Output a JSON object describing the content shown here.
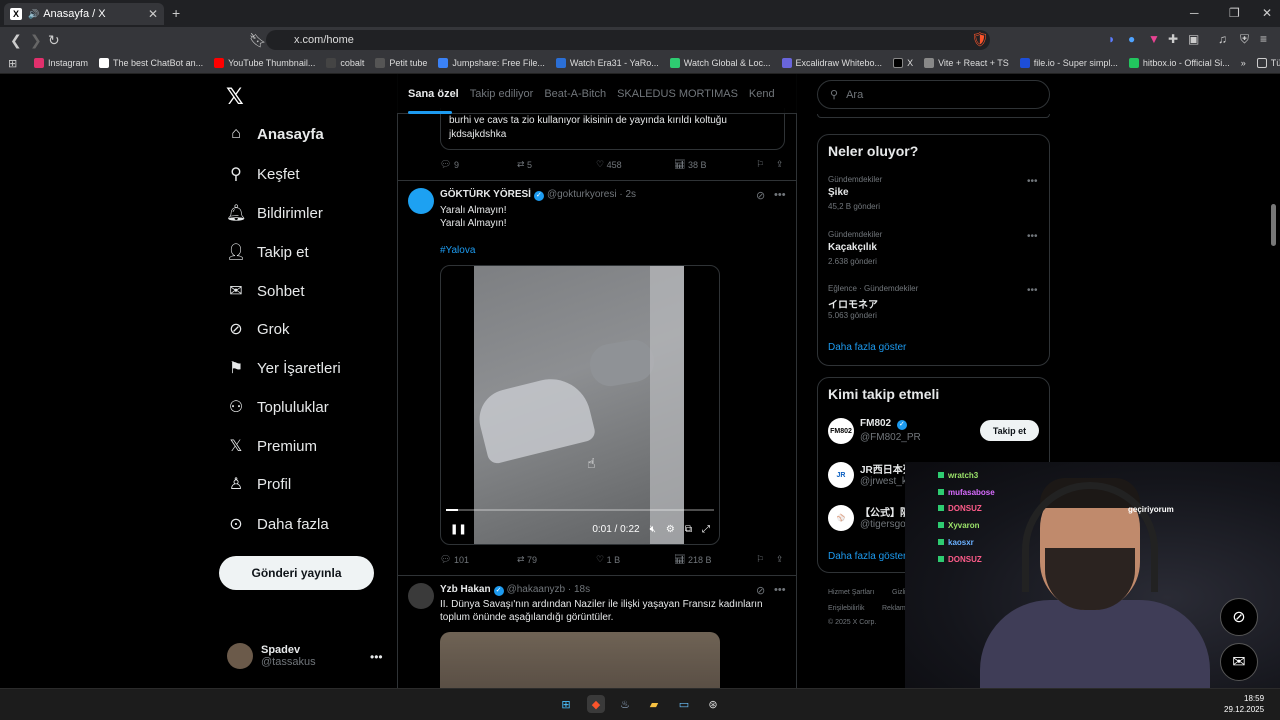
{
  "browser": {
    "tab_title": "Anasayfa / X",
    "url": "x.com/home",
    "bookmarks": [
      "Instagram",
      "The best ChatBot an...",
      "YouTube Thumbnail...",
      "cobalt",
      "Petit tube",
      "Jumpshare: Free File...",
      "Watch Era31 - YaRo...",
      "Watch Global & Loc...",
      "Excalidraw Whitebo...",
      "X",
      "Vite + React + TS",
      "file.io - Super simpl...",
      "hitbox.io - Official Si..."
    ],
    "all_bookmarks": "Tüm Yer İşaretleri"
  },
  "sidebar": {
    "items": [
      {
        "label": "Anasayfa",
        "icon": "home-icon"
      },
      {
        "label": "Keşfet",
        "icon": "search-icon"
      },
      {
        "label": "Bildirimler",
        "icon": "bell-icon"
      },
      {
        "label": "Takip et",
        "icon": "add-person-icon"
      },
      {
        "label": "Sohbet",
        "icon": "mail-icon"
      },
      {
        "label": "Grok",
        "icon": "grok-icon"
      },
      {
        "label": "Yer İşaretleri",
        "icon": "bookmark-icon"
      },
      {
        "label": "Topluluklar",
        "icon": "communities-icon"
      },
      {
        "label": "Premium",
        "icon": "x-logo-icon"
      },
      {
        "label": "Profil",
        "icon": "person-icon"
      },
      {
        "label": "Daha fazla",
        "icon": "more-icon"
      }
    ],
    "post_button": "Gönderi yayınla",
    "user_name": "Spadev",
    "user_handle": "@tassakus"
  },
  "timeline": {
    "tabs": [
      "Sana özel",
      "Takip ediliyor",
      "Beat-A-Bitch",
      "SKALEDUS MORTIMAS",
      "Kend"
    ],
    "quote_text_1": "burhi ve cavs ta zio kullanıyor ikisinin de yayında kırıldı koltuğu",
    "quote_text_2": "jkdsajkdshka",
    "quote_actions": {
      "replies": "9",
      "reposts": "5",
      "likes": "458",
      "views": "38 B"
    },
    "tweet1": {
      "name": "GÖKTÜRK YÖRESİ",
      "handle": "@gokturkyoresi",
      "time": "· 2s",
      "line1": "Yaralı Almayın!",
      "line2": "Yaralı Almayın!",
      "hashtag": "#Yalova",
      "video_time": "0:01 / 0:22",
      "video_progress": 0.045,
      "replies": "101",
      "reposts": "79",
      "likes": "1 B",
      "views": "218 B"
    },
    "tweet2": {
      "name": "Yzb Hakan",
      "handle": "@hakaanyzb",
      "time": "· 18s",
      "line1": "II. Dünya Savaşı'nın ardından Naziler ile ilişki yaşayan Fransız kadınların",
      "line2": "toplum önünde aşağılandığı görüntüler."
    }
  },
  "right": {
    "search_placeholder": "Ara",
    "trends_title": "Neler oluyor?",
    "trends": [
      {
        "meta": "Gündemdekiler",
        "name": "Şike",
        "count": "45,2 B gönderi"
      },
      {
        "meta": "Gündemdekiler",
        "name": "Kaçakçılık",
        "count": "2.638 gönderi"
      },
      {
        "meta": "Eğlence · Gündemdekiler",
        "name": "イロモネア",
        "count": "5.063 gönderi"
      }
    ],
    "show_more": "Daha fazla göster",
    "who_title": "Kimi takip etmeli",
    "who": [
      {
        "name": "FM802",
        "handle": "@FM802_PR",
        "follow": "Takip et"
      },
      {
        "name": "JR西日本列車運行情報...",
        "handle": "@jrwest_kinki_op"
      },
      {
        "name": "【公式】阪神タイ",
        "handle": "@tigersgoodsinfo"
      }
    ],
    "who_more": "Daha fazla göster",
    "footer1": "Hizmet Şartları",
    "footer2": "Gizlilik Politikası",
    "footer3": "Erişilebilirlik",
    "footer4": "Reklam bilgisi",
    "footer5": "© 2025 X Corp."
  },
  "stream_chat": [
    {
      "user": "wratch3",
      "color": "#9be36a"
    },
    {
      "user": "mufasabose",
      "color": "#d86cff"
    },
    {
      "user": "DONSUZ",
      "color": "#ff5c8a"
    },
    {
      "user": "Xyvaron",
      "color": "#9be36a"
    },
    {
      "user": "kaosxr",
      "color": "#6ab0ff"
    },
    {
      "user": "DONSUZ",
      "color": "#ff5c8a"
    }
  ],
  "stream_overlay_text": "geçiriyorum",
  "taskbar": {
    "time": "18:59",
    "date": "29.12.2025"
  }
}
